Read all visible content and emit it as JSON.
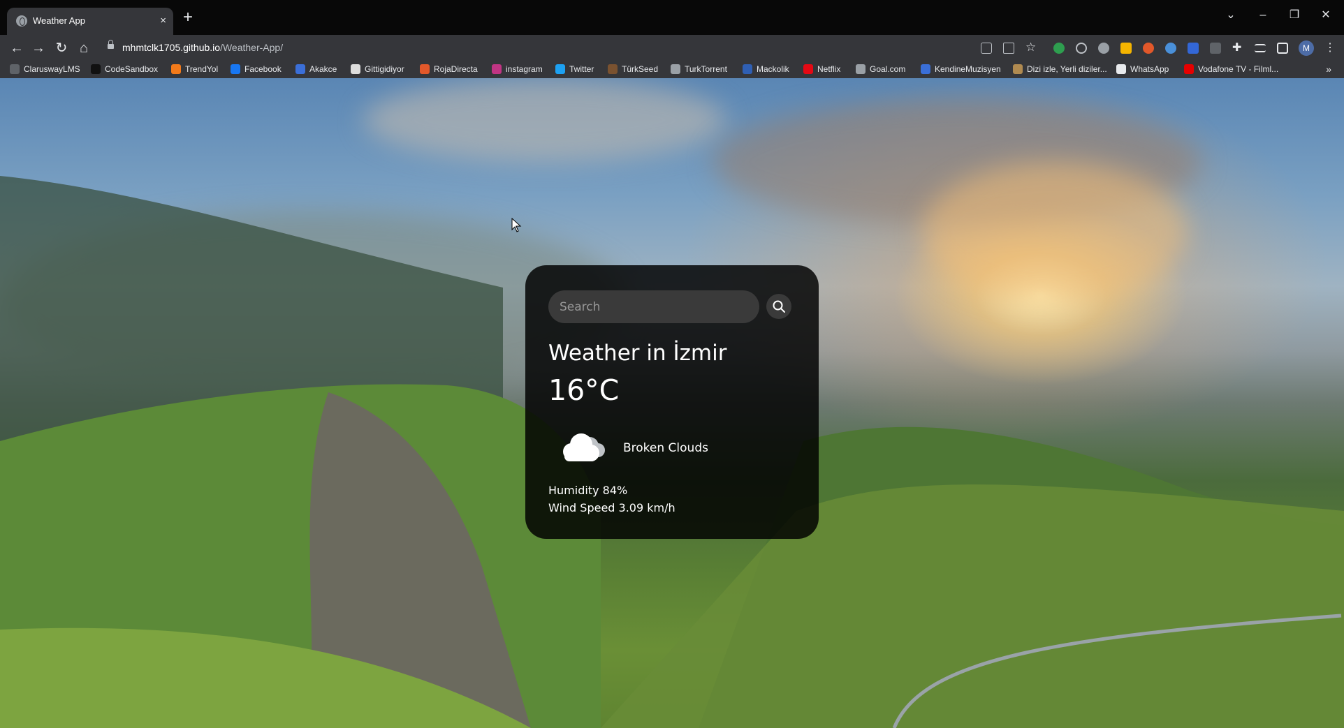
{
  "browser": {
    "tab_title": "Weather App",
    "tab_close": "×",
    "new_tab": "+",
    "url_host": "mhmtclk1705.github.io",
    "url_path": "/Weather-App/",
    "profile_initial": "M",
    "window_controls": {
      "dropdown": "⌄",
      "minimize": "–",
      "restore": "❐",
      "close": "✕"
    },
    "nav": {
      "back": "←",
      "forward": "→",
      "reload": "↻",
      "home": "⌂"
    },
    "bookmarks": [
      {
        "label": "ClaruswayLMS",
        "icon": "clarusway-icon",
        "color": "#5f6368"
      },
      {
        "label": "CodeSandbox",
        "icon": "codesandbox-icon",
        "color": "#111111"
      },
      {
        "label": "TrendYol",
        "icon": "trendyol-icon",
        "color": "#f27a1a"
      },
      {
        "label": "Facebook",
        "icon": "facebook-icon",
        "color": "#1877f2"
      },
      {
        "label": "Akakce",
        "icon": "akakce-icon",
        "color": "#3b6fd8"
      },
      {
        "label": "Gittigidiyor",
        "icon": "gittigidiyor-icon",
        "color": "#dddddd"
      },
      {
        "label": "RojaDirecta",
        "icon": "rojadirecta-icon",
        "color": "#e2582a"
      },
      {
        "label": "instagram",
        "icon": "instagram-icon",
        "color": "#c13584"
      },
      {
        "label": "Twitter",
        "icon": "twitter-icon",
        "color": "#1da1f2"
      },
      {
        "label": "TürkSeed",
        "icon": "turkseed-icon",
        "color": "#7a5230"
      },
      {
        "label": "TurkTorrent",
        "icon": "turktorrent-icon",
        "color": "#9aa0a6"
      },
      {
        "label": "Mackolik",
        "icon": "mackolik-icon",
        "color": "#2f5fb3"
      },
      {
        "label": "Netflix",
        "icon": "netflix-icon",
        "color": "#e50914"
      },
      {
        "label": "Goal.com",
        "icon": "goal-icon",
        "color": "#9aa0a6"
      },
      {
        "label": "KendineMuzisyen",
        "icon": "kendinemuzisyen-icon",
        "color": "#3a6fd8"
      },
      {
        "label": "Dizi izle, Yerli diziler...",
        "icon": "dizi-icon",
        "color": "#b08a50"
      },
      {
        "label": "WhatsApp",
        "icon": "whatsapp-icon",
        "color": "#e8eaed"
      },
      {
        "label": "Vodafone TV - Filml...",
        "icon": "vodafone-icon",
        "color": "#e60000"
      }
    ],
    "bookmarks_more": "»"
  },
  "weather": {
    "search_placeholder": "Search",
    "city_title": "Weather in İzmir",
    "temperature": "16°C",
    "icon": "broken-clouds-icon",
    "description": "Broken Clouds",
    "humidity": "Humidity 84%",
    "wind": "Wind Speed 3.09 km/h"
  }
}
